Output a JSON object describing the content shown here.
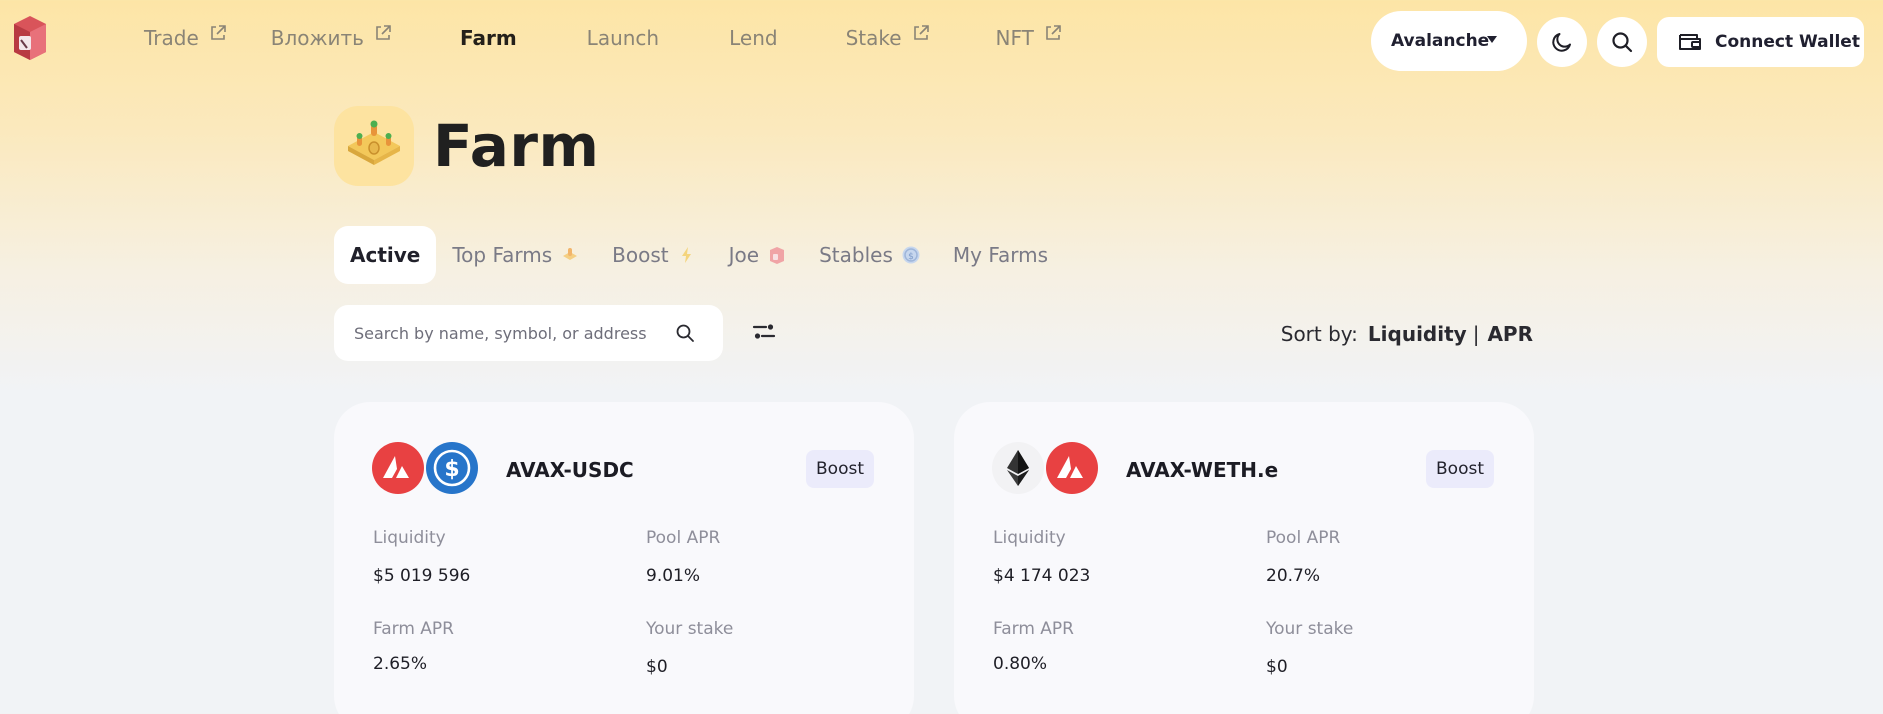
{
  "nav": {
    "items": [
      {
        "label": "Trade",
        "external": true,
        "active": false
      },
      {
        "label": "Вложить",
        "external": true,
        "active": false
      },
      {
        "label": "Farm",
        "external": false,
        "active": true
      },
      {
        "label": "Launch",
        "external": false,
        "active": false
      },
      {
        "label": "Lend",
        "external": false,
        "active": false
      },
      {
        "label": "Stake",
        "external": true,
        "active": false
      },
      {
        "label": "NFT",
        "external": true,
        "active": false
      }
    ]
  },
  "header": {
    "chain": "Avalanche",
    "connect_wallet": "Connect Wallet",
    "icons": {
      "theme": "moon-icon",
      "search": "search-icon",
      "wallet": "wallet-icon"
    }
  },
  "page": {
    "title": "Farm",
    "tabs": [
      {
        "label": "Active",
        "active": true,
        "icon": ""
      },
      {
        "label": "Top Farms",
        "active": false,
        "icon": "top-farms-icon"
      },
      {
        "label": "Boost",
        "active": false,
        "icon": "boost-icon"
      },
      {
        "label": "Joe",
        "active": false,
        "icon": "joe-icon"
      },
      {
        "label": "Stables",
        "active": false,
        "icon": "stables-icon"
      },
      {
        "label": "My Farms",
        "active": false,
        "icon": ""
      }
    ],
    "search": {
      "placeholder": "Search by name, symbol, or address",
      "value": ""
    },
    "sort": {
      "label": "Sort by:",
      "options": [
        "Liquidity",
        "APR"
      ],
      "separator": "|"
    }
  },
  "farms": [
    {
      "pair": "AVAX-USDC",
      "tokens": [
        "avax-token-icon",
        "usdc-token-icon"
      ],
      "badge": "Boost",
      "liquidity_label": "Liquidity",
      "liquidity": "$5 019 596",
      "pool_apr_label": "Pool APR",
      "pool_apr": "9.01%",
      "farm_apr_label": "Farm APR",
      "farm_apr": "2.65%",
      "stake_label": "Your stake",
      "stake": "$0"
    },
    {
      "pair": "AVAX-WETH.e",
      "tokens": [
        "eth-token-icon",
        "avax-token-icon"
      ],
      "badge": "Boost",
      "liquidity_label": "Liquidity",
      "liquidity": "$4 174 023",
      "pool_apr_label": "Pool APR",
      "pool_apr": "20.7%",
      "farm_apr_label": "Farm APR",
      "farm_apr": "0.80%",
      "stake_label": "Your stake",
      "stake": "$0"
    }
  ],
  "colors": {
    "avax": "#e84142",
    "usdc": "#2775ca",
    "eth_bg": "#f2f2f4",
    "badge_bg": "#ebebfb",
    "accent_header": "#fde5a6"
  }
}
